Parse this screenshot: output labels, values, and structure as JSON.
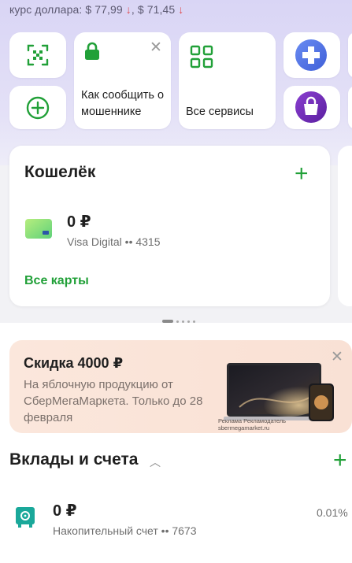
{
  "rates": {
    "label": "курс доллара:",
    "buy": "$ 77,99",
    "separator": ",",
    "sell": "$ 71,45",
    "down_arrow": "↓"
  },
  "quick_tiles": {
    "fraud": {
      "text": "Как сообщить о мошеннике",
      "icon": "lock-icon"
    },
    "services": {
      "text": "Все сервисы",
      "icon": "grid-icon"
    },
    "scan": {
      "icon": "qr-scan-icon"
    },
    "add": {
      "icon": "plus-circle-icon"
    },
    "medical": {
      "icon": "medical-plus-icon"
    },
    "shopping": {
      "icon": "shopping-bag-icon"
    }
  },
  "wallet": {
    "title": "Кошелёк",
    "balance": "0 ₽",
    "card_name": "Visa Digital •• 4315",
    "all_cards": "Все карты"
  },
  "promo": {
    "title": "Скидка 4000 ₽",
    "desc": "На яблочную продукцию от СберМегаМаркета. Только до 28 февраля",
    "ad_note_1": "Реклама Рекламодатель",
    "ad_note_2": "sbermegamarket.ru"
  },
  "deposits": {
    "title": "Вклады и счета",
    "balance": "0 ₽",
    "account_name": "Накопительный счет •• 7673",
    "rate": "0.01%"
  },
  "colors": {
    "accent": "#21a038",
    "rate_down": "#e0484a",
    "header_bg": "#d9d5f5",
    "promo_bg": "#fbe7dc"
  }
}
